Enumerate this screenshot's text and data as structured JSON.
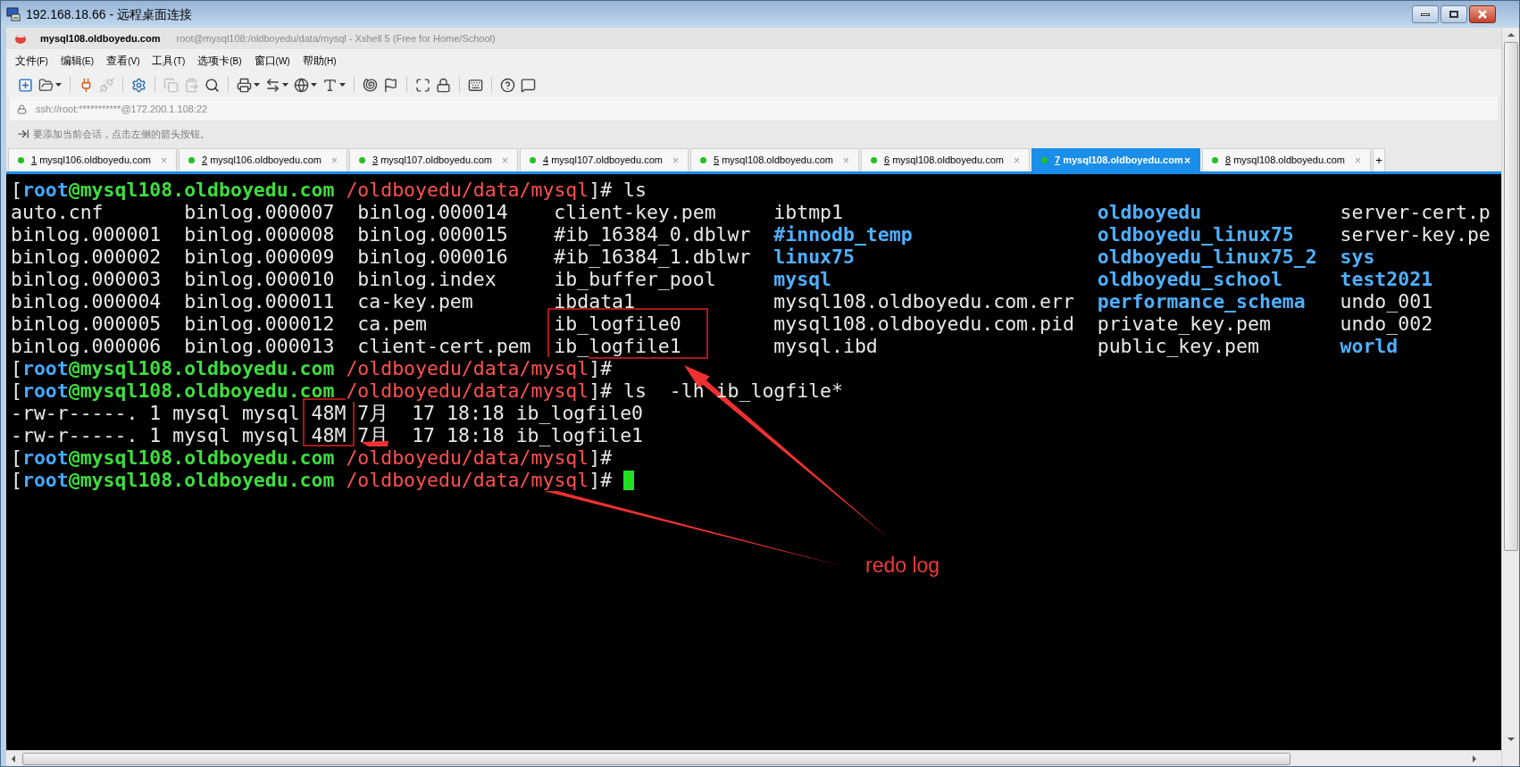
{
  "window": {
    "title": "192.168.18.66 - 远程桌面连接"
  },
  "app": {
    "session": "mysql108.oldboyedu.com",
    "title": "root@mysql108:/oldboyedu/data/mysql - Xshell 5 (Free for Home/School)"
  },
  "menu": [
    {
      "label": "文件",
      "key": "(F)"
    },
    {
      "label": "编辑",
      "key": "(E)"
    },
    {
      "label": "查看",
      "key": "(V)"
    },
    {
      "label": "工具",
      "key": "(T)"
    },
    {
      "label": "选项卡",
      "key": "(B)"
    },
    {
      "label": "窗口",
      "key": "(W)"
    },
    {
      "label": "帮助",
      "key": "(H)"
    }
  ],
  "toolbar": [
    {
      "items": [
        {
          "disabled": false,
          "dropdown": false
        },
        {
          "disabled": false,
          "dropdown": true
        }
      ]
    },
    {
      "items": [
        {
          "disabled": false,
          "dropdown": false
        },
        {
          "disabled": true,
          "dropdown": false
        }
      ]
    },
    {
      "items": [
        {
          "disabled": false,
          "dropdown": false
        }
      ]
    },
    {
      "items": [
        {
          "disabled": true,
          "dropdown": false
        },
        {
          "disabled": true,
          "dropdown": false
        },
        {
          "disabled": false,
          "dropdown": false
        }
      ]
    },
    {
      "items": [
        {
          "disabled": false,
          "dropdown": true
        },
        {
          "disabled": false,
          "dropdown": true
        },
        {
          "disabled": false,
          "dropdown": true
        },
        {
          "disabled": false,
          "dropdown": true
        }
      ]
    },
    {
      "items": [
        {
          "disabled": false,
          "dropdown": false
        },
        {
          "disabled": false,
          "dropdown": false
        }
      ]
    },
    {
      "items": [
        {
          "disabled": false,
          "dropdown": false
        },
        {
          "disabled": false,
          "dropdown": false
        }
      ]
    },
    {
      "items": [
        {
          "disabled": false,
          "dropdown": false
        }
      ]
    },
    {
      "items": [
        {
          "disabled": false,
          "dropdown": false
        },
        {
          "disabled": false,
          "dropdown": false
        }
      ]
    }
  ],
  "address": "ssh://root:***********@172.200.1.108:22",
  "hint": "要添加当前会话，点击左侧的箭头按钮。",
  "tabs": [
    {
      "number": "1",
      "label": "mysql106.oldboyedu.com",
      "selected": false,
      "close": "×"
    },
    {
      "number": "2",
      "label": "mysql106.oldboyedu.com",
      "selected": false,
      "close": "×"
    },
    {
      "number": "3",
      "label": "mysql107.oldboyedu.com",
      "selected": false,
      "close": "×"
    },
    {
      "number": "4",
      "label": "mysql107.oldboyedu.com",
      "selected": false,
      "close": "×"
    },
    {
      "number": "5",
      "label": "mysql108.oldboyedu.com",
      "selected": false,
      "close": "×"
    },
    {
      "number": "6",
      "label": "mysql108.oldboyedu.com",
      "selected": false,
      "close": "×"
    },
    {
      "number": "7",
      "label": "mysql108.oldboyedu.com",
      "selected": true,
      "close": "×"
    },
    {
      "number": "8",
      "label": "mysql108.oldboyedu.com",
      "selected": false,
      "close": "×"
    }
  ],
  "new_tab": "+",
  "terminal": {
    "lines": [
      {
        "kind": "prompt",
        "open": "[",
        "user": "root",
        "host": "@mysql108.oldboyedu.com",
        "path": "/oldboyedu/data/mysql",
        "close": "]#",
        "command": "ls"
      },
      {
        "kind": "listing",
        "cells": [
          {
            "text": "auto.cnf",
            "kind": "file"
          },
          {
            "text": "binlog.000007",
            "kind": "file"
          },
          {
            "text": "binlog.000014",
            "kind": "file"
          },
          {
            "text": "client-key.pem",
            "kind": "file"
          },
          {
            "text": "ibtmp1",
            "kind": "file"
          },
          {
            "text": "oldboyedu",
            "kind": "dir"
          },
          {
            "text": "server-cert.p",
            "kind": "file"
          }
        ]
      },
      {
        "kind": "listing",
        "cells": [
          {
            "text": "binlog.000001",
            "kind": "file"
          },
          {
            "text": "binlog.000008",
            "kind": "file"
          },
          {
            "text": "binlog.000015",
            "kind": "file"
          },
          {
            "text": "#ib_16384_0.dblwr",
            "kind": "file"
          },
          {
            "text": "#innodb_temp",
            "kind": "dir"
          },
          {
            "text": "oldboyedu_linux75",
            "kind": "dir"
          },
          {
            "text": "server-key.pe",
            "kind": "file"
          }
        ]
      },
      {
        "kind": "listing",
        "cells": [
          {
            "text": "binlog.000002",
            "kind": "file"
          },
          {
            "text": "binlog.000009",
            "kind": "file"
          },
          {
            "text": "binlog.000016",
            "kind": "file"
          },
          {
            "text": "#ib_16384_1.dblwr",
            "kind": "file"
          },
          {
            "text": "linux75",
            "kind": "dir"
          },
          {
            "text": "oldboyedu_linux75_2",
            "kind": "dir"
          },
          {
            "text": "sys",
            "kind": "dir"
          }
        ]
      },
      {
        "kind": "listing",
        "cells": [
          {
            "text": "binlog.000003",
            "kind": "file"
          },
          {
            "text": "binlog.000010",
            "kind": "file"
          },
          {
            "text": "binlog.index",
            "kind": "file"
          },
          {
            "text": "ib_buffer_pool",
            "kind": "file"
          },
          {
            "text": "mysql",
            "kind": "dir"
          },
          {
            "text": "oldboyedu_school",
            "kind": "dir"
          },
          {
            "text": "test2021",
            "kind": "dir"
          }
        ]
      },
      {
        "kind": "listing",
        "cells": [
          {
            "text": "binlog.000004",
            "kind": "file"
          },
          {
            "text": "binlog.000011",
            "kind": "file"
          },
          {
            "text": "ca-key.pem",
            "kind": "file"
          },
          {
            "text": "ibdata1",
            "kind": "file"
          },
          {
            "text": "mysql108.oldboyedu.com.err",
            "kind": "file"
          },
          {
            "text": "performance_schema",
            "kind": "dir"
          },
          {
            "text": "undo_001",
            "kind": "file"
          }
        ]
      },
      {
        "kind": "listing",
        "cells": [
          {
            "text": "binlog.000005",
            "kind": "file"
          },
          {
            "text": "binlog.000012",
            "kind": "file"
          },
          {
            "text": "ca.pem",
            "kind": "file"
          },
          {
            "text": "ib_logfile0",
            "kind": "file"
          },
          {
            "text": "mysql108.oldboyedu.com.pid",
            "kind": "file"
          },
          {
            "text": "private_key.pem",
            "kind": "file"
          },
          {
            "text": "undo_002",
            "kind": "file"
          }
        ]
      },
      {
        "kind": "listing",
        "cells": [
          {
            "text": "binlog.000006",
            "kind": "file"
          },
          {
            "text": "binlog.000013",
            "kind": "file"
          },
          {
            "text": "client-cert.pem",
            "kind": "file"
          },
          {
            "text": "ib_logfile1",
            "kind": "file"
          },
          {
            "text": "mysql.ibd",
            "kind": "file"
          },
          {
            "text": "public_key.pem",
            "kind": "file"
          },
          {
            "text": "world",
            "kind": "dir"
          }
        ]
      },
      {
        "kind": "prompt",
        "open": "[",
        "user": "root",
        "host": "@mysql108.oldboyedu.com",
        "path": "/oldboyedu/data/mysql",
        "close": "]#"
      },
      {
        "kind": "prompt",
        "open": "[",
        "user": "root",
        "host": "@mysql108.oldboyedu.com",
        "path": "/oldboyedu/data/mysql",
        "close": "]#",
        "command": "ls  -lh ib_logfile*"
      },
      {
        "kind": "output",
        "text": "-rw-r-----. 1 mysql mysql 48M 7月  17 18:18 ib_logfile0"
      },
      {
        "kind": "output",
        "text": "-rw-r-----. 1 mysql mysql 48M 7月  17 18:18 ib_logfile1"
      },
      {
        "kind": "prompt",
        "open": "[",
        "user": "root",
        "host": "@mysql108.oldboyedu.com",
        "path": "/oldboyedu/data/mysql",
        "close": "]#"
      },
      {
        "kind": "prompt",
        "open": "[",
        "user": "root",
        "host": "@mysql108.oldboyedu.com",
        "path": "/oldboyedu/data/mysql",
        "close": "]#",
        "cursor": true
      }
    ]
  },
  "annotation": "redo log"
}
